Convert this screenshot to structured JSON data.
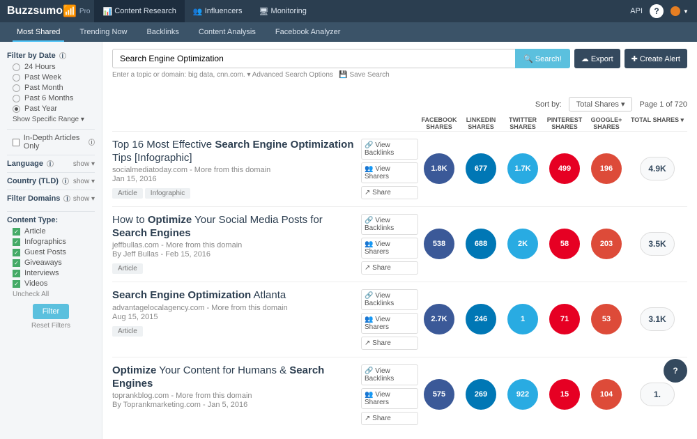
{
  "brand": {
    "name": "Buzzsumo",
    "tier": "Pro"
  },
  "topnav": [
    {
      "label": "Content Research",
      "active": true
    },
    {
      "label": "Influencers",
      "active": false
    },
    {
      "label": "Monitoring",
      "active": false
    }
  ],
  "api_label": "API",
  "subtabs": [
    {
      "label": "Most Shared",
      "active": true
    },
    {
      "label": "Trending Now"
    },
    {
      "label": "Backlinks"
    },
    {
      "label": "Content Analysis"
    },
    {
      "label": "Facebook Analyzer"
    }
  ],
  "search": {
    "value": "Search Engine Optimization",
    "button": "Search!",
    "export": "Export",
    "create_alert": "Create Alert",
    "hint_pre": "Enter a topic or domain: big data, cnn.com.",
    "adv": "Advanced Search Options",
    "save": "Save Search"
  },
  "sort": {
    "label": "Sort by:",
    "selected": "Total Shares",
    "page": "Page 1 of 720"
  },
  "columns": {
    "fb": "FACEBOOK SHARES",
    "li": "LINKEDIN SHARES",
    "tw": "TWITTER SHARES",
    "pi": "PINTEREST SHARES",
    "gp": "GOOGLE+ SHARES",
    "total": "TOTAL SHARES"
  },
  "sidebar": {
    "date": {
      "title": "Filter by Date",
      "options": [
        "24 Hours",
        "Past Week",
        "Past Month",
        "Past 6 Months",
        "Past Year"
      ],
      "selected": 4,
      "range": "Show Specific Range"
    },
    "indepth": "In-Depth Articles Only",
    "language": {
      "t": "Language",
      "s": "show"
    },
    "country": {
      "t": "Country (TLD)",
      "s": "show"
    },
    "domains": {
      "t": "Filter Domains",
      "s": "show"
    },
    "content": {
      "title": "Content Type:",
      "items": [
        "Article",
        "Infographics",
        "Guest Posts",
        "Giveaways",
        "Interviews",
        "Videos"
      ]
    },
    "uncheck": "Uncheck All",
    "filter": "Filter",
    "reset": "Reset Filters"
  },
  "actions": {
    "backlinks": "View Backlinks",
    "sharers": "View Sharers",
    "share": "Share"
  },
  "results": [
    {
      "title_pre": "Top 16 Most Effective ",
      "title_b": "Search Engine Optimization",
      "title_post": " Tips [Infographic]",
      "domain": "socialmediatoday.com",
      "more": " - More from this domain",
      "byline": "",
      "date": "Jan 15, 2016",
      "tags": [
        "Article",
        "Infographic"
      ],
      "fb": "1.8K",
      "li": "677",
      "tw": "1.7K",
      "pi": "499",
      "gp": "196",
      "total": "4.9K"
    },
    {
      "title_pre": "How to ",
      "title_b": "Optimize",
      "title_mid": " Your Social Media Posts for ",
      "title_b2": "Search Engines",
      "domain": "jeffbullas.com",
      "more": " - More from this domain",
      "byline": "By Jeff Bullas - Feb 15, 2016",
      "date": "",
      "tags": [
        "Article"
      ],
      "fb": "538",
      "li": "688",
      "tw": "2K",
      "pi": "58",
      "gp": "203",
      "total": "3.5K"
    },
    {
      "title_pre": "",
      "title_b": "Search Engine Optimization",
      "title_post": "  Atlanta",
      "domain": "advantagelocalagency.com",
      "more": " - More from this domain",
      "byline": "",
      "date": "Aug 15, 2015",
      "tags": [
        "Article"
      ],
      "fb": "2.7K",
      "li": "246",
      "tw": "1",
      "pi": "71",
      "gp": "53",
      "total": "3.1K"
    },
    {
      "title_pre": "",
      "title_b": "Optimize",
      "title_mid": " Your Content for Humans & ",
      "title_b2": "Search Engines",
      "domain": "toprankblog.com",
      "more": " - More from this domain",
      "byline": "By Toprankmarketing.com - Jan 5, 2016",
      "date": "",
      "tags": [],
      "fb": "575",
      "li": "269",
      "tw": "922",
      "pi": "15",
      "gp": "104",
      "total": "1."
    }
  ]
}
